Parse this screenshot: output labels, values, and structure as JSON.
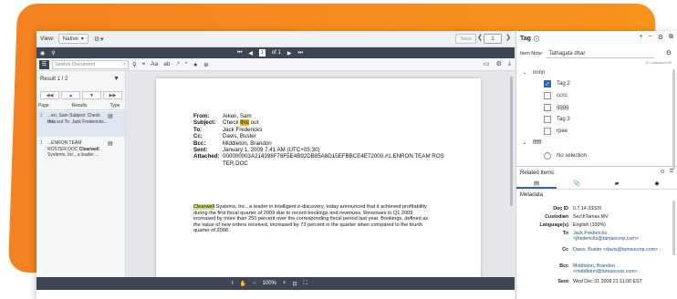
{
  "toolbar": {
    "view_label": "View:",
    "view_mode": "Native",
    "gear_icon": "gear-icon",
    "save_label": "Save",
    "page_number": "1"
  },
  "viewer_nav": {
    "page_text": "1",
    "of_text": "of 1"
  },
  "search": {
    "placeholder": "Search Document"
  },
  "results": {
    "title": "Result 1 / 2",
    "columns": [
      "Page",
      "Results",
      "Type"
    ],
    "items": [
      {
        "num": "1",
        "text_before": "...en, Sam Subject: Check ",
        "highlight": "this",
        "text_after": " out To: Jack Fredericks..."
      },
      {
        "num": "1",
        "text_before": "...ENRON TEAM ROSTER.DOC ",
        "highlight": "Clearwell",
        "text_after": " Systems, Inc., a leader ..."
      }
    ]
  },
  "email": {
    "from_label": "From:",
    "from": "Aiken, Sam",
    "subject_label": "Subject:",
    "subject_pre": "Check ",
    "subject_hl": "this",
    "subject_post": " out",
    "to_label": "To:",
    "to": "Jack Fredericks",
    "cc_label": "Cc:",
    "cc": "Davis, Buster",
    "bcc_label": "Bcc:",
    "bcc": "Middleton, Brandon",
    "sent_label": "Sent:",
    "sent": "January 1, 2009 7:41 AM (UTC+05:30)",
    "attached_label": "Attached:",
    "attached": "000000003A214398F78F5E4B92DB85A8D15EFBBCE4E72000.#1.ENRON TEAM ROSTER.DOC",
    "body_hl": "Clearwell",
    "body": " Systems, Inc., a leader in intelligent e-discovery, today announced that it achieved profitability during the first fiscal quarter of 2009 due to record bookings and revenues. Revenues in Q1 2009 increased by more than 250 percent over the corresponding fiscal period last year. Bookings, defined as the value of new orders received, increased by 73 percent in the quarter when compared to the fourth quarter of 2008."
  },
  "zoom": {
    "level": "100%"
  },
  "tag_panel": {
    "title": "Tag",
    "item_note_label": "Item Note:",
    "item_note_value": "Tathagata dhar",
    "chars_left": "241 characters left",
    "groups": [
      {
        "name": "nnnn",
        "items": [
          {
            "label": "Tag 2",
            "checked": true
          },
          {
            "label": "cccc",
            "checked": false
          },
          {
            "label": "gggg",
            "checked": false
          },
          {
            "label": "Tag 3",
            "checked": false
          },
          {
            "label": "rpee",
            "checked": false
          }
        ]
      },
      {
        "name": "ffffff",
        "items": [
          {
            "label": "No selection",
            "radio": true
          }
        ]
      }
    ]
  },
  "related": {
    "title": "Related Items",
    "metadata_title": "Metadata",
    "fields": [
      {
        "key": "Doc ID",
        "value": "0.7.14.33320"
      },
      {
        "key": "Custodian",
        "value": "Sec\\hTamas.MV"
      },
      {
        "key": "Language(s)",
        "value": "English (100%)"
      },
      {
        "key": "To",
        "value": "Jack Fredericks <jfredericks@tamascorp.com> ;"
      },
      {
        "key": "Cc",
        "value": "Davis, Buster <davis@tamascorp.com> ;"
      },
      {
        "key": "Bcc",
        "value": "Middleton, Brandon <middleton@tamascorp.com> ;"
      },
      {
        "key": "Sent",
        "value": "Wed Dec 31 2008 21:11:00 EST"
      }
    ]
  }
}
